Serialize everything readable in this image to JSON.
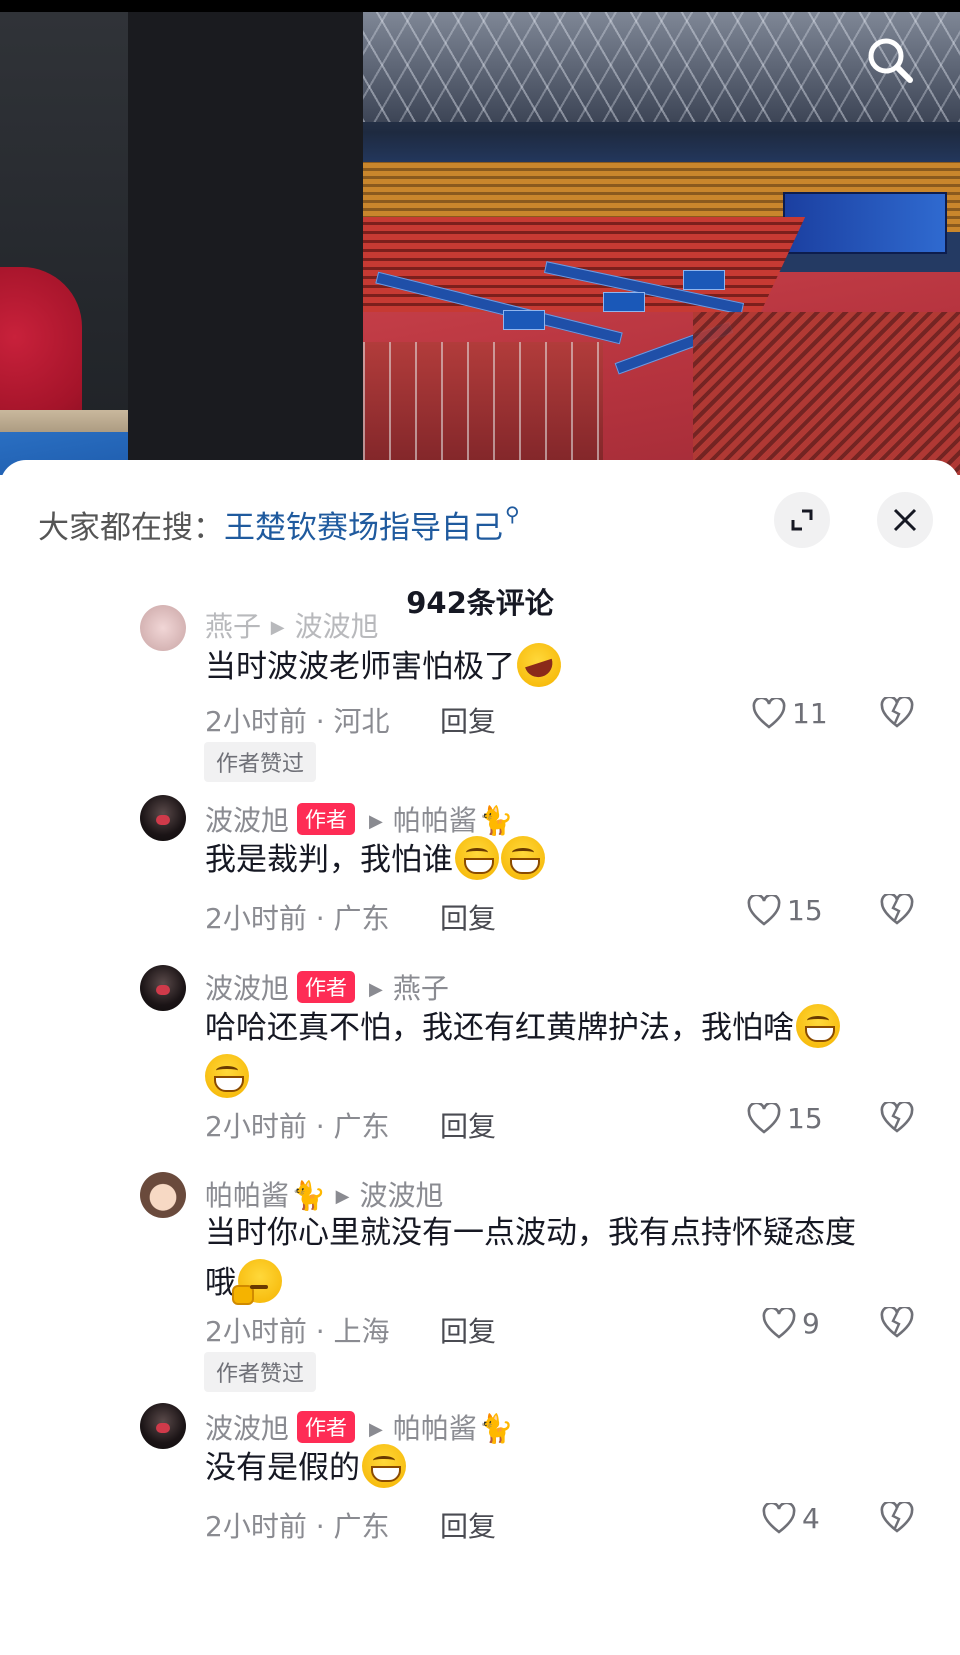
{
  "search": {
    "prefix": "大家都在搜：",
    "keyword": "王楚钦赛场指导自己"
  },
  "comment_count": "942条评论",
  "comments": [
    {
      "name": "燕子",
      "reply_to": "波波旭",
      "text": "当时波波老师害怕极了",
      "time": "2小时前 · 河北",
      "reply": "回复",
      "likes": "11",
      "tag": "作者赞过"
    },
    {
      "name": "波波旭",
      "badge": "作者",
      "reply_to": "帕帕酱",
      "text": "我是裁判，我怕谁",
      "time": "2小时前 · 广东",
      "reply": "回复",
      "likes": "15"
    },
    {
      "name": "波波旭",
      "badge": "作者",
      "reply_to": "燕子",
      "text": "哈哈还真不怕，我还有红黄牌护法，我怕啥",
      "time": "2小时前 · 广东",
      "reply": "回复",
      "likes": "15"
    },
    {
      "name": "帕帕酱",
      "reply_to": "波波旭",
      "text": "当时你心里就没有一点波动，我有点持怀疑态度哦",
      "time": "2小时前 · 上海",
      "reply": "回复",
      "likes": "9",
      "tag": "作者赞过"
    },
    {
      "name": "波波旭",
      "badge": "作者",
      "reply_to": "帕帕酱",
      "text": "没有是假的",
      "time": "2小时前 · 广东",
      "reply": "回复",
      "likes": "4"
    }
  ],
  "colors": {
    "author_badge": "#fe2c55",
    "keyword": "#1f5a9e",
    "muted": "#8a8b91"
  },
  "icons": [
    "search-icon",
    "expand-icon",
    "close-icon",
    "heart-icon",
    "dislike-icon",
    "cat-emoji",
    "grin-emoji",
    "laugh-emoji",
    "think-emoji"
  ]
}
